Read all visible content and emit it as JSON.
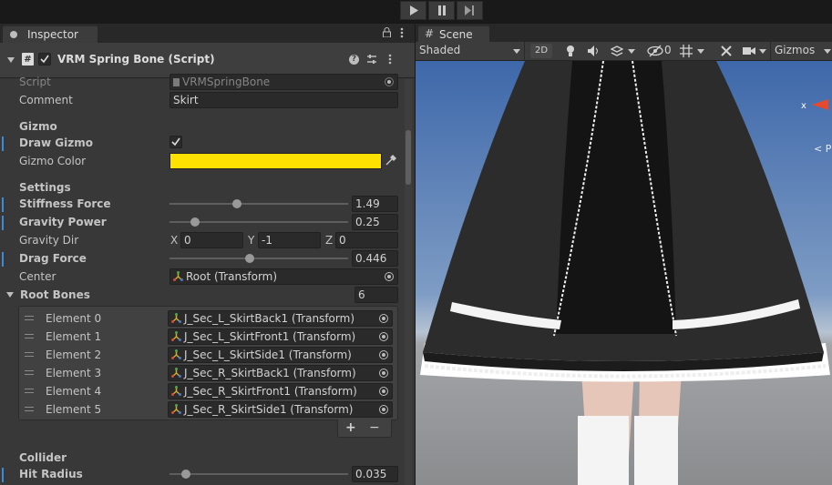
{
  "toolbar": {
    "play_icon": "play-icon",
    "pause_icon": "pause-icon",
    "step_icon": "step-icon"
  },
  "inspector": {
    "tab_label": "Inspector",
    "component_title": "VRM Spring Bone (Script)",
    "script_label": "Script",
    "script_value": "VRMSpringBone",
    "comment_label": "Comment",
    "comment_value": "Skirt",
    "gizmo_section": "Gizmo",
    "draw_gizmo_label": "Draw Gizmo",
    "draw_gizmo_checked": true,
    "gizmo_color_label": "Gizmo Color",
    "gizmo_color": "#ffe100",
    "settings_section": "Settings",
    "stiffness_label": "Stiffness Force",
    "stiffness_value": "1.49",
    "gravity_power_label": "Gravity Power",
    "gravity_power_value": "0.25",
    "gravity_dir_label": "Gravity Dir",
    "gravity_dir": {
      "x_label": "X",
      "x": "0",
      "y_label": "Y",
      "y": "-1",
      "z_label": "Z",
      "z": "0"
    },
    "drag_force_label": "Drag Force",
    "drag_force_value": "0.446",
    "center_label": "Center",
    "center_value": "Root (Transform)",
    "root_bones_label": "Root Bones",
    "root_bones_count": "6",
    "root_bones": [
      {
        "label": "Element 0",
        "value": "J_Sec_L_SkirtBack1 (Transform)"
      },
      {
        "label": "Element 1",
        "value": "J_Sec_L_SkirtFront1 (Transform)"
      },
      {
        "label": "Element 2",
        "value": "J_Sec_L_SkirtSide1 (Transform)"
      },
      {
        "label": "Element 3",
        "value": "J_Sec_R_SkirtBack1 (Transform)"
      },
      {
        "label": "Element 4",
        "value": "J_Sec_R_SkirtFront1 (Transform)"
      },
      {
        "label": "Element 5",
        "value": "J_Sec_R_SkirtSide1 (Transform)"
      }
    ],
    "add_label": "+",
    "remove_label": "−",
    "collider_section": "Collider",
    "hit_radius_label": "Hit Radius",
    "hit_radius_value": "0.035"
  },
  "scene": {
    "tab_label": "Scene",
    "shading_mode": "Shaded",
    "mode_2d": "2D",
    "hidden_count": "0",
    "gizmos_label": "Gizmos",
    "axis_x_label": "x",
    "persp_label": "< P"
  }
}
